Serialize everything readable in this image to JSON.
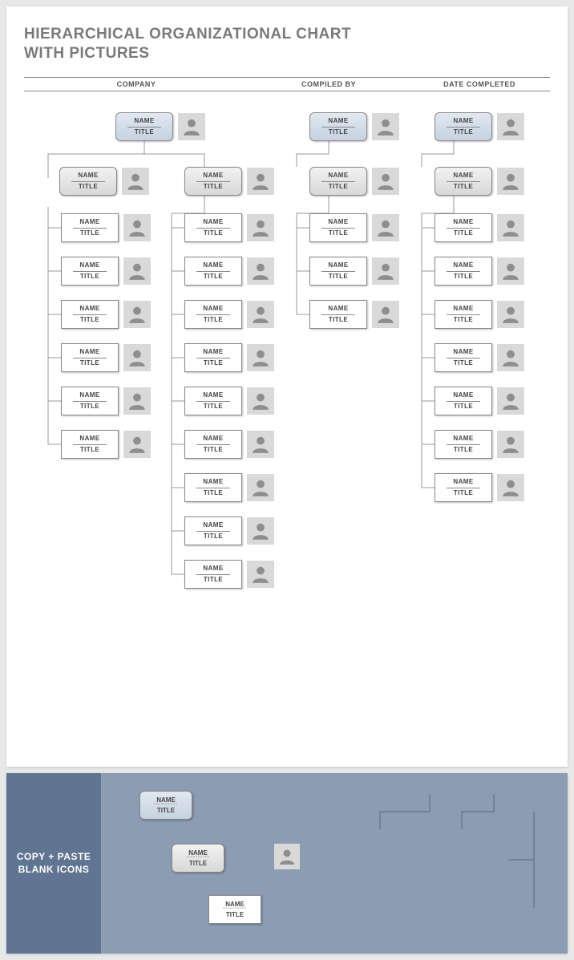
{
  "title_line1": "HIERARCHICAL ORGANIZATIONAL CHART",
  "title_line2": "WITH PICTURES",
  "headers": {
    "company": "COMPANY",
    "compiled": "COMPILED BY",
    "date": "DATE COMPLETED"
  },
  "labels": {
    "name": "NAME",
    "title": "TITLE"
  },
  "panel2": {
    "side": "COPY + PASTE BLANK ICONS"
  },
  "chart_data": {
    "type": "tree",
    "description": "Four-branch org-chart template: one overall root feeds two L2 sub-branches on the left; two independent vertical branches on the right. Every person box shows NAME / TITLE with an avatar placeholder.",
    "branches": [
      {
        "id": "A",
        "root": {
          "name": "NAME",
          "title": "TITLE",
          "style": "blue"
        },
        "level2": [
          {
            "id": "A-L",
            "node": {
              "name": "NAME",
              "title": "TITLE",
              "style": "gray"
            },
            "children_count": 6,
            "children": [
              {
                "name": "NAME",
                "title": "TITLE",
                "style": "white"
              },
              {
                "name": "NAME",
                "title": "TITLE",
                "style": "white"
              },
              {
                "name": "NAME",
                "title": "TITLE",
                "style": "white"
              },
              {
                "name": "NAME",
                "title": "TITLE",
                "style": "white"
              },
              {
                "name": "NAME",
                "title": "TITLE",
                "style": "white"
              },
              {
                "name": "NAME",
                "title": "TITLE",
                "style": "white"
              }
            ]
          },
          {
            "id": "A-R",
            "node": {
              "name": "NAME",
              "title": "TITLE",
              "style": "gray"
            },
            "children_count": 9,
            "children": [
              {
                "name": "NAME",
                "title": "TITLE",
                "style": "white"
              },
              {
                "name": "NAME",
                "title": "TITLE",
                "style": "white"
              },
              {
                "name": "NAME",
                "title": "TITLE",
                "style": "white"
              },
              {
                "name": "NAME",
                "title": "TITLE",
                "style": "white"
              },
              {
                "name": "NAME",
                "title": "TITLE",
                "style": "white"
              },
              {
                "name": "NAME",
                "title": "TITLE",
                "style": "white"
              },
              {
                "name": "NAME",
                "title": "TITLE",
                "style": "white"
              },
              {
                "name": "NAME",
                "title": "TITLE",
                "style": "white"
              },
              {
                "name": "NAME",
                "title": "TITLE",
                "style": "white"
              }
            ]
          }
        ]
      },
      {
        "id": "B",
        "root": {
          "name": "NAME",
          "title": "TITLE",
          "style": "blue"
        },
        "level2": [
          {
            "id": "B1",
            "node": {
              "name": "NAME",
              "title": "TITLE",
              "style": "gray"
            },
            "children_count": 3,
            "children": [
              {
                "name": "NAME",
                "title": "TITLE",
                "style": "white"
              },
              {
                "name": "NAME",
                "title": "TITLE",
                "style": "white"
              },
              {
                "name": "NAME",
                "title": "TITLE",
                "style": "white"
              }
            ]
          }
        ]
      },
      {
        "id": "C",
        "root": {
          "name": "NAME",
          "title": "TITLE",
          "style": "blue"
        },
        "level2": [
          {
            "id": "C1",
            "node": {
              "name": "NAME",
              "title": "TITLE",
              "style": "gray"
            },
            "children_count": 7,
            "children": [
              {
                "name": "NAME",
                "title": "TITLE",
                "style": "white"
              },
              {
                "name": "NAME",
                "title": "TITLE",
                "style": "white"
              },
              {
                "name": "NAME",
                "title": "TITLE",
                "style": "white"
              },
              {
                "name": "NAME",
                "title": "TITLE",
                "style": "white"
              },
              {
                "name": "NAME",
                "title": "TITLE",
                "style": "white"
              },
              {
                "name": "NAME",
                "title": "TITLE",
                "style": "white"
              },
              {
                "name": "NAME",
                "title": "TITLE",
                "style": "white"
              }
            ]
          }
        ]
      }
    ]
  }
}
